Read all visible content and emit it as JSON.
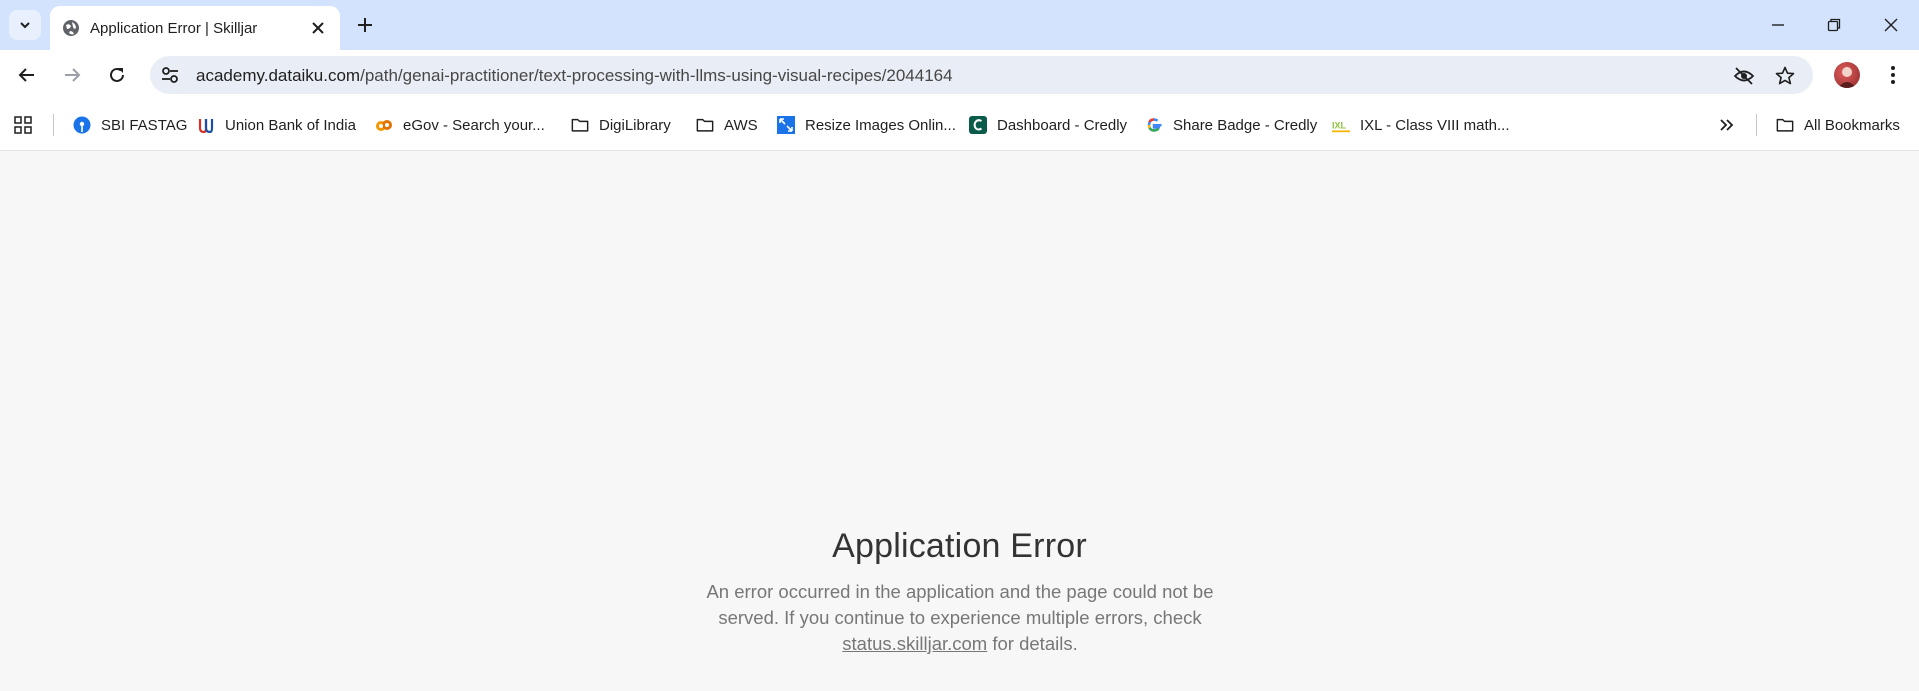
{
  "browser": {
    "tab": {
      "title": "Application Error | Skilljar"
    },
    "omnibox": {
      "url_host": "academy.dataiku.com",
      "url_path": "/path/genai-practitioner/text-processing-with-llms-using-visual-recipes/2044164"
    },
    "bookmarks": [
      {
        "label": "SBI FASTAG",
        "icon": "sbi-icon"
      },
      {
        "label": "Union Bank of India",
        "icon": "union-bank-icon"
      },
      {
        "label": "eGov - Search your...",
        "icon": "egov-icon"
      },
      {
        "label": "DigiLibrary",
        "icon": "folder-icon"
      },
      {
        "label": "AWS",
        "icon": "folder-icon"
      },
      {
        "label": "Resize Images Onlin...",
        "icon": "resize-icon"
      },
      {
        "label": "Dashboard - Credly",
        "icon": "credly-icon"
      },
      {
        "label": "Share Badge - Credly",
        "icon": "google-icon"
      },
      {
        "label": "IXL - Class VIII math...",
        "icon": "ixl-icon"
      }
    ],
    "all_bookmarks": "All Bookmarks"
  },
  "page": {
    "error_title": "Application Error",
    "error_text_1": "An error occurred in the application and the page could not be served. If you continue to experience multiple errors, check",
    "status_link": "status.skilljar.com",
    "error_text_2": "for details."
  },
  "colors": {
    "tabstrip": "#d3e3fd",
    "omnibox": "#e9eef6",
    "page_bg": "#f7f7f7"
  }
}
